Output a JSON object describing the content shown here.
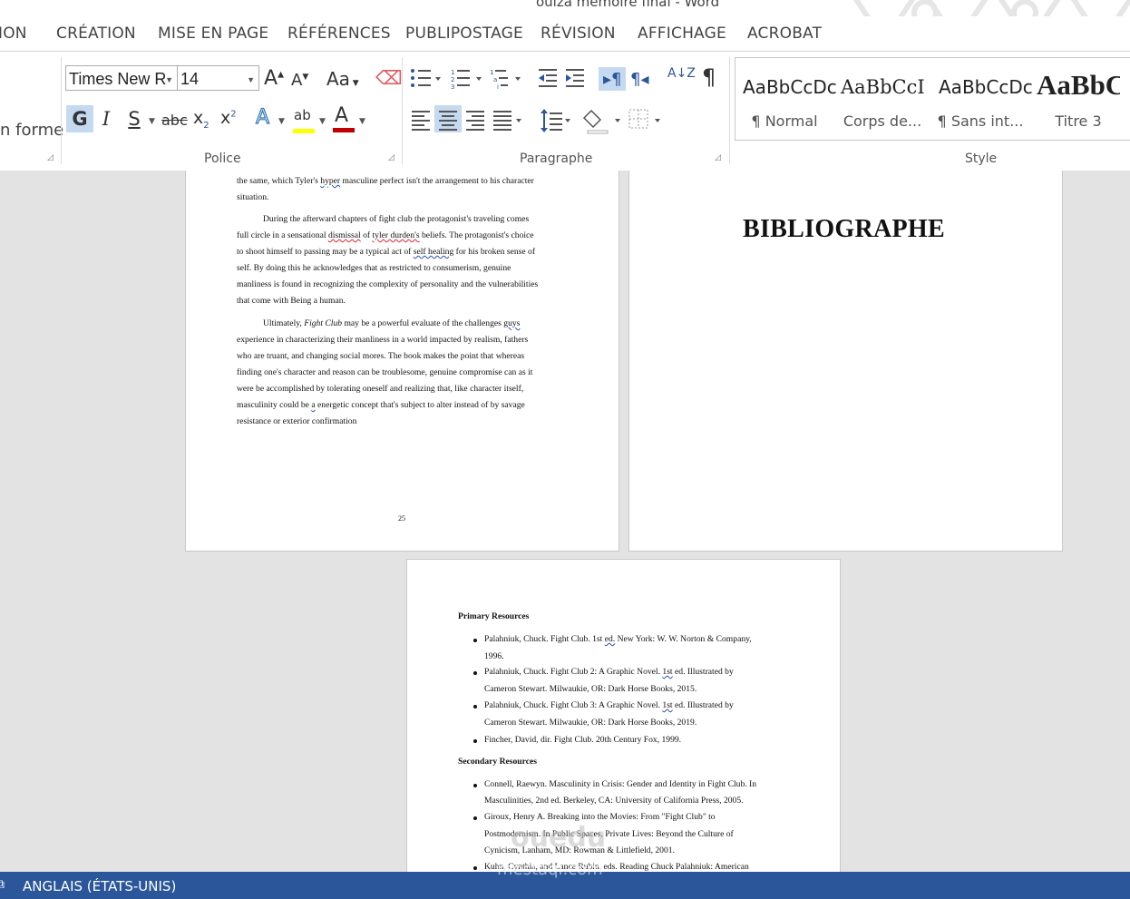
{
  "window": {
    "title": "ouiza mémoire final - Word"
  },
  "tabs": [
    "ION",
    "CRÉATION",
    "MISE EN PAGE",
    "RÉFÉRENCES",
    "PUBLIPOSTAGE",
    "RÉVISION",
    "AFFICHAGE",
    "ACROBAT"
  ],
  "ribbon": {
    "clipboard_partial": "n forme",
    "font": {
      "label": "Police",
      "family": "Times New R",
      "size": "14",
      "grow": "A",
      "shrink": "A",
      "case": "Aa",
      "bold": "G",
      "italic": "I",
      "underline": "S",
      "strike": "abc",
      "sub": "x",
      "sub_small": "2",
      "sup": "x",
      "sup_small": "2",
      "effects": "A",
      "highlight": "ab",
      "color": "A",
      "highlight_color": "#ffff00",
      "font_color": "#c00000"
    },
    "paragraph": {
      "label": "Paragraphe",
      "sort": "A↓Z",
      "pilcrow": "¶"
    },
    "styles": {
      "label": "Style",
      "items": [
        {
          "sample": "AaBbCcDc",
          "name": "¶ Normal"
        },
        {
          "sample": "AaBbCcI",
          "name": "Corps de..."
        },
        {
          "sample": "AaBbCcDc",
          "name": "¶ Sans int..."
        },
        {
          "sample": "AaBbC",
          "name": "Titre 3"
        }
      ]
    }
  },
  "document": {
    "page_left": {
      "lines": [
        "the same, which Tyler's hyper masculine perfect isn't the arrangement to his character",
        "situation.",
        "During the afterward chapters of fight club the protagonist's traveling comes",
        "full circle in a sensational dismissal of tyler durden's beliefs. The protagonist's choice",
        "to shoot himself to passing may be a typical act of self healing for his broken sense of",
        "self. By doing this he acknowledges that as restricted to consumerism, genuine",
        "manliness is found in recognizing the complexity of personality and the vulnerabilities",
        "that come with Being a human.",
        "Ultimately, Fight Club may be a powerful evaluate of the challenges guys",
        "experience in characterizing their manliness in a world impacted by realism, fathers",
        "who are truant, and changing social mores. The book makes the point that whereas",
        "finding one's character and reason can be troublesome, genuine compromise can as it",
        "were be accomplished by tolerating oneself and realizing that, like character itself,",
        "masculinity could be a energetic concept that's subject to alter instead of by savage",
        "resistance or exterior confirmation"
      ],
      "page_number": "25"
    },
    "page_right": {
      "heading": "BIBLIOGRAPHE"
    },
    "page_bottom": {
      "primary_heading": "Primary Resources",
      "primary": [
        [
          "Palahniuk, Chuck. Fight Club. 1st ed. New York: W. W. Norton & Company,",
          "1996."
        ],
        [
          "Palahniuk, Chuck. Fight Club 2: A Graphic Novel. 1st ed. Illustrated by",
          "Cameron Stewart. Milwaukie, OR: Dark Horse Books, 2015."
        ],
        [
          "Palahniuk, Chuck. Fight Club 3: A Graphic Novel. 1st ed. Illustrated by",
          "Cameron Stewart. Milwaukie, OR: Dark Horse Books, 2019."
        ],
        [
          "Fincher, David, dir. Fight Club. 20th Century Fox, 1999."
        ]
      ],
      "secondary_heading": "Secondary Resources",
      "secondary": [
        [
          "Connell, Raewyn. Masculinity in Crisis: Gender and Identity in Fight Club. In",
          "Masculinities, 2nd ed. Berkeley, CA: University of California Press, 2005."
        ],
        [
          "Giroux, Henry A. Breaking into the Movies: From \"Fight Club\" to",
          "Postmodernism. In Public Spaces, Private Lives: Beyond the Culture of",
          "Cynicism, Lanham, MD: Rowman & Littlefield, 2001."
        ],
        [
          "Kuhn, Cynthia, and Lance Rubin, eds. Reading Chuck Palahniuk: American"
        ]
      ]
    }
  },
  "status": {
    "language": "ANGLAIS (ÉTATS-UNIS)"
  },
  "watermark": {
    "line1": "ouedu",
    "line2": "mestaqi.com"
  }
}
